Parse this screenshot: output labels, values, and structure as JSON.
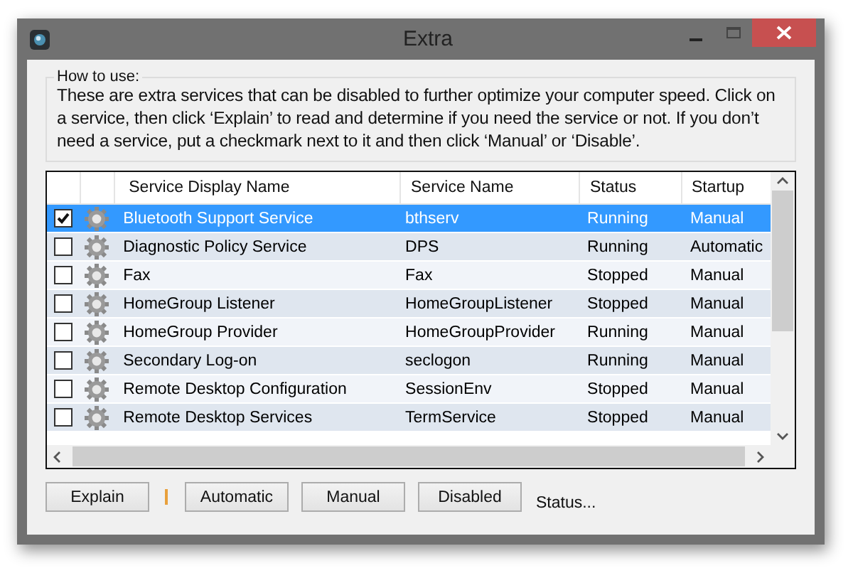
{
  "window": {
    "title": "Extra"
  },
  "help": {
    "legend": "How to use:",
    "text": "These are extra services that can be disabled to further optimize your computer speed. Click on a service, then click ‘Explain’ to read and determine if you need the service or not. If you don’t need a service, put a checkmark next to it and then click ‘Manual’ or ‘Disable’."
  },
  "table": {
    "columns": [
      "Service Display Name",
      "Service Name",
      "Status",
      "Startup"
    ],
    "rows": [
      {
        "checked": true,
        "selected": true,
        "display_name": "Bluetooth Support Service",
        "service_name": "bthserv",
        "status": "Running",
        "startup": "Manual"
      },
      {
        "checked": false,
        "selected": false,
        "display_name": "Diagnostic Policy Service",
        "service_name": "DPS",
        "status": "Running",
        "startup": "Automatic"
      },
      {
        "checked": false,
        "selected": false,
        "display_name": "Fax",
        "service_name": "Fax",
        "status": "Stopped",
        "startup": "Manual"
      },
      {
        "checked": false,
        "selected": false,
        "display_name": "HomeGroup Listener",
        "service_name": "HomeGroupListener",
        "status": "Stopped",
        "startup": "Manual"
      },
      {
        "checked": false,
        "selected": false,
        "display_name": "HomeGroup Provider",
        "service_name": "HomeGroupProvider",
        "status": "Running",
        "startup": "Manual"
      },
      {
        "checked": false,
        "selected": false,
        "display_name": "Secondary Log-on",
        "service_name": "seclogon",
        "status": "Running",
        "startup": "Manual"
      },
      {
        "checked": false,
        "selected": false,
        "display_name": "Remote Desktop Configuration",
        "service_name": "SessionEnv",
        "status": "Stopped",
        "startup": "Manual"
      },
      {
        "checked": false,
        "selected": false,
        "display_name": "Remote Desktop Services",
        "service_name": "TermService",
        "status": "Stopped",
        "startup": "Manual"
      }
    ]
  },
  "buttons": [
    "Explain",
    "Automatic",
    "Manual",
    "Disabled"
  ],
  "status_bar": "Status..."
}
